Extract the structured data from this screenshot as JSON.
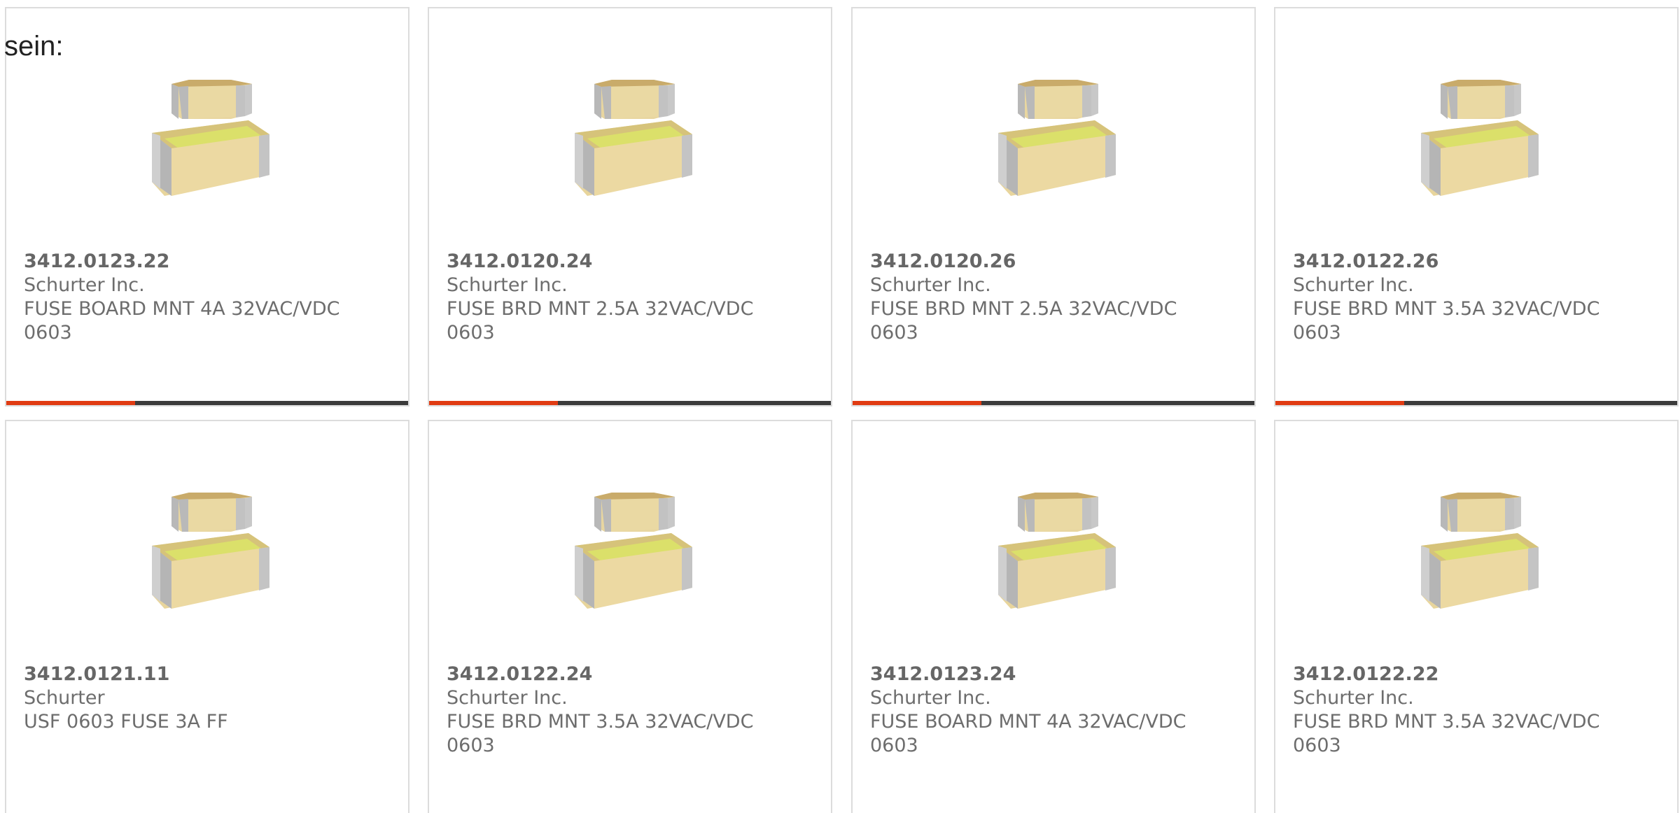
{
  "intro_text": "sein:",
  "icons": {
    "product_image": "smd-fuse-chip-image"
  },
  "colors": {
    "accent": "#e03b12",
    "bar_track": "#3b3b3b",
    "card_border": "#dcdcdc",
    "text": "#6d6d6d"
  },
  "cards": [
    {
      "part_number": "3412.0123.22",
      "manufacturer": "Schurter Inc.",
      "description": "FUSE BOARD MNT 4A 32VAC/VDC",
      "package": "0603"
    },
    {
      "part_number": "3412.0120.24",
      "manufacturer": "Schurter Inc.",
      "description": "FUSE BRD MNT 2.5A 32VAC/VDC",
      "package": "0603"
    },
    {
      "part_number": "3412.0120.26",
      "manufacturer": "Schurter Inc.",
      "description": "FUSE BRD MNT 2.5A 32VAC/VDC",
      "package": "0603"
    },
    {
      "part_number": "3412.0122.26",
      "manufacturer": "Schurter Inc.",
      "description": "FUSE BRD MNT 3.5A 32VAC/VDC",
      "package": "0603"
    },
    {
      "part_number": "3412.0121.11",
      "manufacturer": "Schurter",
      "description": "USF 0603 FUSE 3A FF",
      "package": ""
    },
    {
      "part_number": "3412.0122.24",
      "manufacturer": "Schurter Inc.",
      "description": "FUSE BRD MNT 3.5A 32VAC/VDC",
      "package": "0603"
    },
    {
      "part_number": "3412.0123.24",
      "manufacturer": "Schurter Inc.",
      "description": "FUSE BOARD MNT 4A 32VAC/VDC",
      "package": "0603"
    },
    {
      "part_number": "3412.0122.22",
      "manufacturer": "Schurter Inc.",
      "description": "FUSE BRD MNT 3.5A 32VAC/VDC",
      "package": "0603"
    }
  ]
}
